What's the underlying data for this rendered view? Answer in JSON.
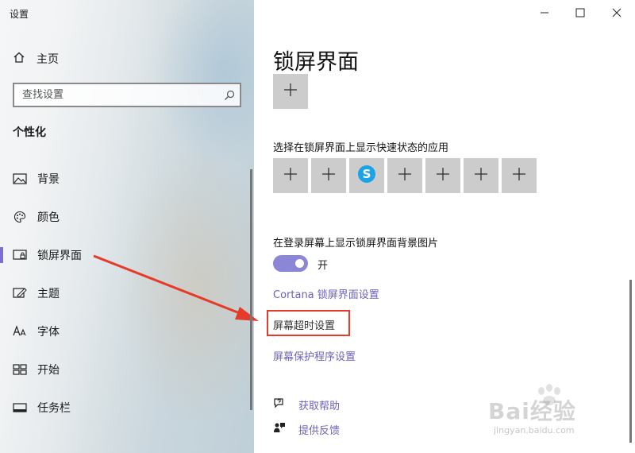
{
  "window": {
    "app_title": "设置",
    "controls": [
      "minimize-icon",
      "maximize-icon",
      "close-icon"
    ]
  },
  "sidebar": {
    "home_label": "主页",
    "search_placeholder": "查找设置",
    "section_title": "个性化",
    "items": [
      {
        "label": "背景",
        "icon": "picture-icon",
        "active": false
      },
      {
        "label": "颜色",
        "icon": "palette-icon",
        "active": false
      },
      {
        "label": "锁屏界面",
        "icon": "lock-screen-icon",
        "active": true
      },
      {
        "label": "主题",
        "icon": "theme-icon",
        "active": false
      },
      {
        "label": "字体",
        "icon": "font-icon",
        "active": false
      },
      {
        "label": "开始",
        "icon": "start-icon",
        "active": false
      },
      {
        "label": "任务栏",
        "icon": "taskbar-icon",
        "active": false
      }
    ],
    "accent_color": "#7c6fd0"
  },
  "main": {
    "page_title": "锁屏界面",
    "quick_status_label": "选择在锁屏界面上显示快速状态的应用",
    "quick_status_tiles": [
      "plus",
      "plus",
      "skype",
      "plus",
      "plus",
      "plus",
      "plus"
    ],
    "background_label": "在登录屏幕上显示锁屏界面背景图片",
    "background_toggle": {
      "on": true,
      "state_label": "开"
    },
    "links": {
      "cortana": "Cortana 锁屏界面设置",
      "timeout": "屏幕超时设置",
      "screensaver": "屏幕保护程序设置"
    },
    "help": {
      "get_help": "获取帮助",
      "feedback": "提供反馈"
    },
    "link_color": "#6b63b5",
    "highlight_color": "#e53b2a"
  },
  "watermark": {
    "brand": "Bai经验",
    "url": "jingyan.baidu.com"
  }
}
